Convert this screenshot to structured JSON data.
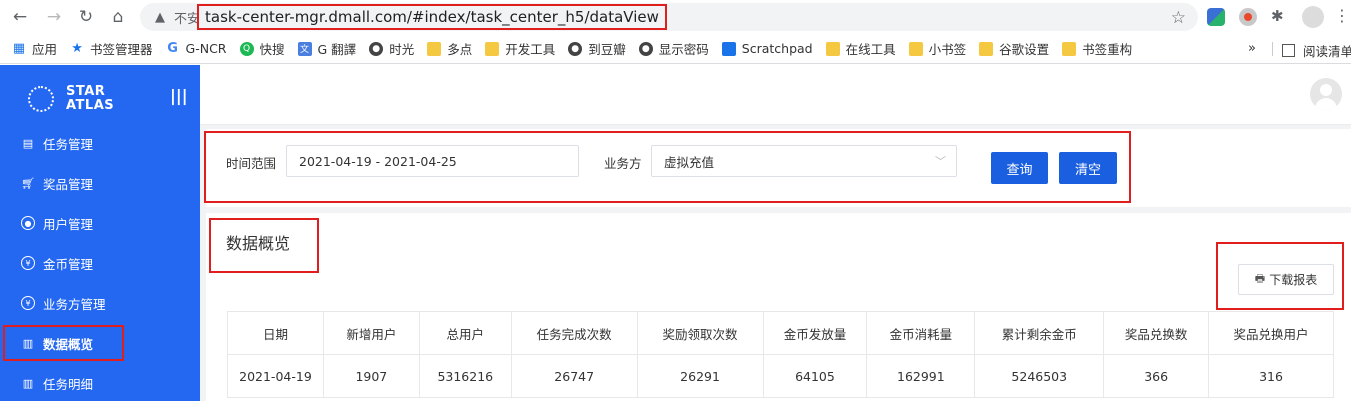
{
  "browser": {
    "insecure_label": "不安全",
    "url": "task-center-mgr.dmall.com/#index/task_center_h5/dataView",
    "bookmarks": [
      "应用",
      "书签管理器",
      "G-NCR",
      "快搜",
      "G 翻譯",
      "时光",
      "多点",
      "开发工具",
      "到豆瓣",
      "显示密码",
      "Scratchpad",
      "在线工具",
      "小书签",
      "谷歌设置",
      "书签重构"
    ],
    "more": "»",
    "reading_list": "阅读清单"
  },
  "sidebar": {
    "logo_line1": "STAR",
    "logo_line2": "ATLAS",
    "items": [
      {
        "label": "任务管理"
      },
      {
        "label": "奖品管理"
      },
      {
        "label": "用户管理"
      },
      {
        "label": "金币管理"
      },
      {
        "label": "业务方管理"
      },
      {
        "label": "数据概览"
      },
      {
        "label": "任务明细"
      }
    ]
  },
  "filter": {
    "time_label": "时间范围",
    "date_range": "2021-04-19 - 2021-04-25",
    "biz_label": "业务方",
    "biz_value": "虚拟充值",
    "query_label": "查询",
    "clear_label": "清空"
  },
  "overview": {
    "title": "数据概览",
    "download_label": "下载报表",
    "columns": [
      "日期",
      "新增用户",
      "总用户",
      "任务完成次数",
      "奖励领取次数",
      "金币发放量",
      "金币消耗量",
      "累计剩余金币",
      "奖品兑换数",
      "奖品兑换用户"
    ],
    "rows": [
      [
        "2021-04-19",
        "1907",
        "5316216",
        "26747",
        "26291",
        "64105",
        "162991",
        "5246503",
        "366",
        "316"
      ]
    ]
  }
}
